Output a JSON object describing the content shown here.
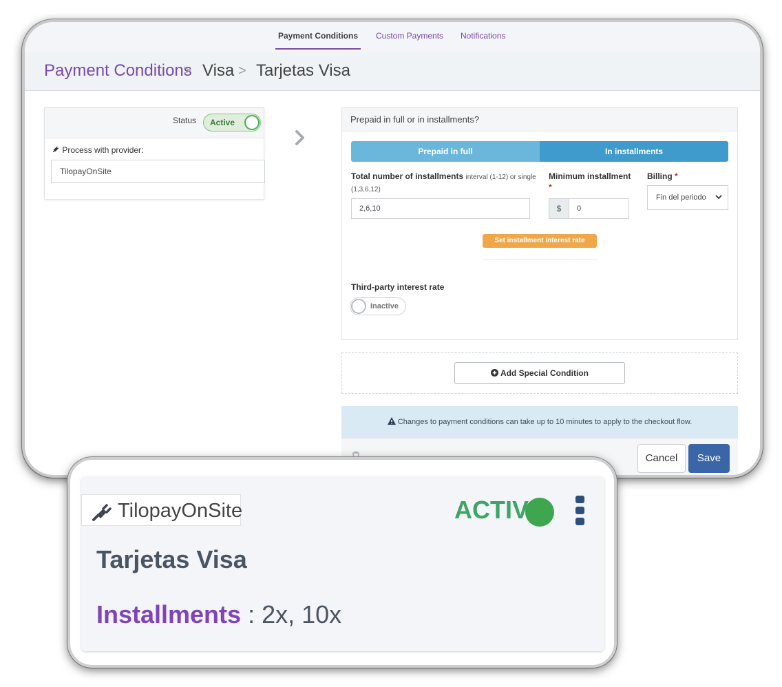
{
  "tabs": [
    {
      "label": "Payment Conditions",
      "active": true
    },
    {
      "label": "Custom Payments",
      "active": false
    },
    {
      "label": "Notifications",
      "active": false
    }
  ],
  "breadcrumb": {
    "items": [
      "Payment Conditions",
      "Visa",
      "Tarjetas Visa"
    ],
    "separator": ">"
  },
  "provider_card": {
    "status_label": "Status",
    "status_value": "Active",
    "provider_label": "Process with provider:",
    "provider_value": "TilopayOnSite"
  },
  "installments_panel": {
    "heading": "Prepaid in full or in installments?",
    "segments": [
      "Prepaid in full",
      "In installments"
    ],
    "total_label": "Total number of installments",
    "total_hint": "interval (1-12) or single (1,3,6,12)",
    "total_value": "2,6,10",
    "min_label": "Minimum installment",
    "required_mark": "*",
    "currency_symbol": "$",
    "min_value": "0",
    "billing_label": "Billing",
    "billing_value": "Fin del periodo",
    "interest_button": "Set installment interest rate",
    "third_party_label": "Third-party interest rate",
    "third_party_value": "Inactive"
  },
  "special_condition_button": "Add Special Condition",
  "notice": "Changes to payment conditions can take up to 10 minutes to apply to the checkout flow.",
  "footer": {
    "cancel": "Cancel",
    "save": "Save"
  },
  "summary_card": {
    "provider": "TilopayOnSite",
    "status": "ACTIVE",
    "title": "Tarjetas Visa",
    "installments_key": "Installments",
    "installments_sep": " : ",
    "installments_value": "2x, 10x"
  },
  "colors": {
    "accent": "#7a4aa8",
    "segment_light": "#6bb7dc",
    "segment_dark": "#3f9bcb",
    "orange": "#f0a74a",
    "save": "#3a66a7",
    "active_green": "#3ea566",
    "notice_bg": "#d9eaf4"
  },
  "icons": [
    "plug-icon",
    "chevron-right-icon",
    "chevron-down-icon",
    "plus-circle-icon",
    "warning-icon",
    "trash-icon",
    "kebab-menu-icon"
  ]
}
